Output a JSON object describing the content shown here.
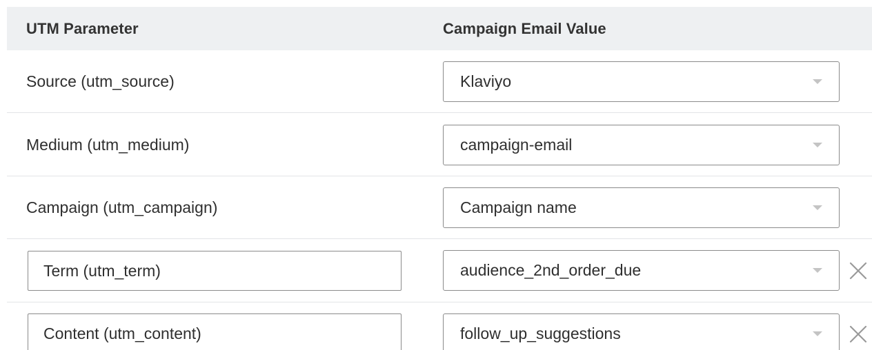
{
  "header": {
    "param_col": "UTM Parameter",
    "value_col": "Campaign Email Value"
  },
  "rows": [
    {
      "param": "Source (utm_source)",
      "value": "Klaviyo"
    },
    {
      "param": "Medium (utm_medium)",
      "value": "campaign-email"
    },
    {
      "param": "Campaign (utm_campaign)",
      "value": "Campaign name"
    },
    {
      "param": "Term (utm_term)",
      "value": "audience_2nd_order_due"
    },
    {
      "param": "Content (utm_content)",
      "value": "follow_up_suggestions"
    }
  ],
  "icons": {
    "dropdown": "chevron-down-icon",
    "remove": "close-icon"
  },
  "colors": {
    "header_bg": "#eef0f2",
    "border": "#8a8a8a",
    "divider": "#e2e4e7",
    "caret": "#c4c4c4",
    "remove_icon": "#9a9a9a"
  }
}
